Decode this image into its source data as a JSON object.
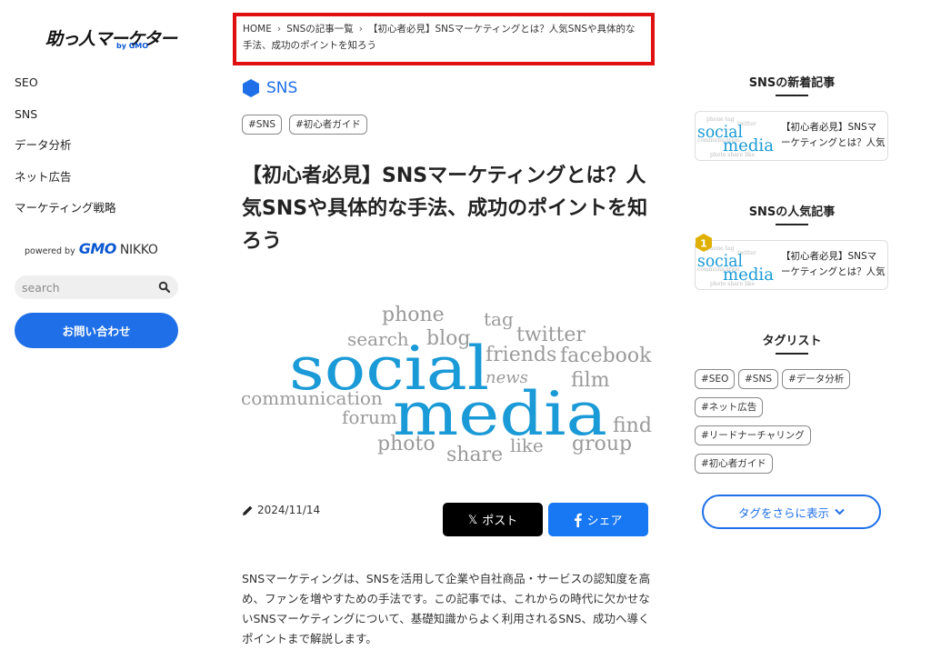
{
  "logo": {
    "main": "助っ人マーケター",
    "sub": "by GMO"
  },
  "nav": {
    "items": [
      "SEO",
      "SNS",
      "データ分析",
      "ネット広告",
      "マーケティング戦略"
    ]
  },
  "powered": {
    "prefix": "powered by",
    "gmo": "GMO",
    "nikko": "NIKKO"
  },
  "search": {
    "placeholder": "search"
  },
  "contact_button": "お問い合わせ",
  "breadcrumb": {
    "home": "HOME",
    "list": "SNSの記事一覧",
    "current": "【初心者必見】SNSマーケティングとは？人気SNSや具体的な手法、成功のポイントを知ろう"
  },
  "category": {
    "label": "SNS",
    "color": "#1e6fe8"
  },
  "tags": [
    "#SNS",
    "#初心者ガイド"
  ],
  "title": "【初心者必見】SNSマーケティングとは？人気SNSや具体的な手法、成功のポイントを知ろう",
  "hero_words": {
    "social": "social",
    "media": "media",
    "phone": "phone",
    "tag": "tag",
    "search": "search",
    "blog": "blog",
    "twitter": "twitter",
    "friends": "friends",
    "facebook": "facebook",
    "news": "news",
    "film": "film",
    "communication": "communication",
    "forum": "forum",
    "find": "find",
    "photo": "photo",
    "share": "share",
    "like": "like",
    "group": "group"
  },
  "date": "2024/11/14",
  "share": {
    "x_label": "ポスト",
    "fb_label": "シェア"
  },
  "intro": "SNSマーケティングは、SNSを活用して企業や自社商品・サービスの認知度を高め、ファンを増やすための手法です。この記事では、これからの時代に欠かせないSNSマーケティングについて、基礎知識からよく利用されるSNS、成功へ導くポイントまで解説します。",
  "sidebar": {
    "new_heading": "SNSの新着記事",
    "new_card_title": "【初心者必見】SNSマーケティングとは？人気SNSや具体的な手法、成功のポイントを知ろう",
    "popular_heading": "SNSの人気記事",
    "popular_rank": "1",
    "popular_card_title": "【初心者必見】SNSマーケティングとは？人気SNSや具体的な手法、成功のポイントを知ろう",
    "taglist_heading": "タグリスト",
    "taglist": [
      "#SEO",
      "#SNS",
      "#データ分析",
      "#ネット広告",
      "#リードナーチャリング",
      "#初心者ガイド"
    ],
    "more_tags": "タグをさらに表示"
  },
  "colors": {
    "accent": "#1e6fe8",
    "highlight_border": "#e01010",
    "rank_badge": "#e0b000",
    "wordcloud_blue": "#1a9ad6",
    "wordcloud_gray": "#9a9a9a"
  }
}
